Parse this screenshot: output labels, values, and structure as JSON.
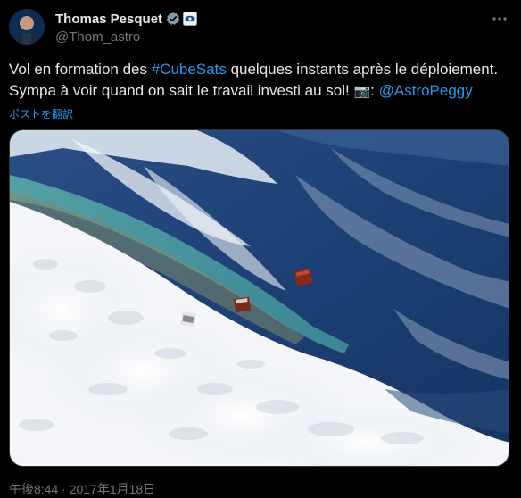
{
  "author": {
    "display_name": "Thomas Pesquet",
    "handle": "@Thom_astro"
  },
  "tweet": {
    "line1_prefix": "Vol en formation des ",
    "line1_hashtag": "#CubeSats",
    "line1_suffix": " quelques instants après le déploiement.",
    "line2_text": "Sympa à voir quand on sait le travail investi au sol! ",
    "line2_emoji": "📷",
    "line2_colon": ": ",
    "line2_mention": "@AstroPeggy",
    "translate_label": "ポストを翻訳",
    "timestamp": "午後8:44 · 2017年1月18日"
  },
  "icons": {
    "verified": "verified-badge-icon",
    "affiliation": "esa-affiliation-icon",
    "more": "more-options-icon"
  },
  "colors": {
    "background": "#000000",
    "text": "#e7e9ea",
    "muted": "#71767b",
    "link": "#1d9bf0"
  }
}
